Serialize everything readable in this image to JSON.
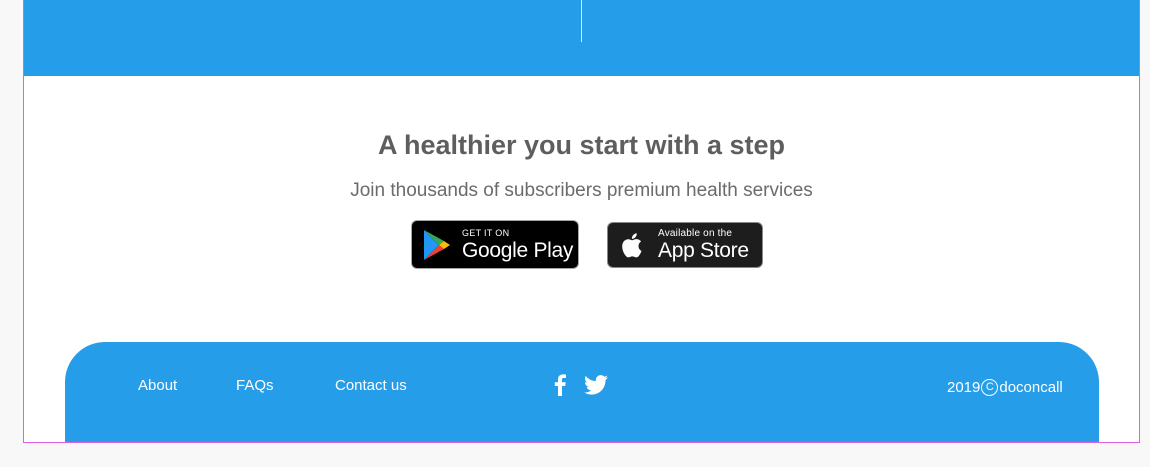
{
  "promo": {
    "title": "A healthier you start with a step",
    "subtitle": "Join thousands of subscribers premium health services"
  },
  "badges": {
    "google": {
      "small": "GET IT ON",
      "big": "Google Play"
    },
    "apple": {
      "small": "Available on the",
      "big": "App Store"
    }
  },
  "footer": {
    "links": [
      "About",
      "FAQs",
      "Contact us"
    ],
    "social": [
      "facebook-icon",
      "twitter-icon"
    ],
    "copyright_year": "2019",
    "copyright_mark": "C",
    "copyright_brand": "doconcall"
  },
  "colors": {
    "brand_blue": "#269de8",
    "text_gray": "#5e5e5e",
    "frame_outline": "#e060e0"
  }
}
